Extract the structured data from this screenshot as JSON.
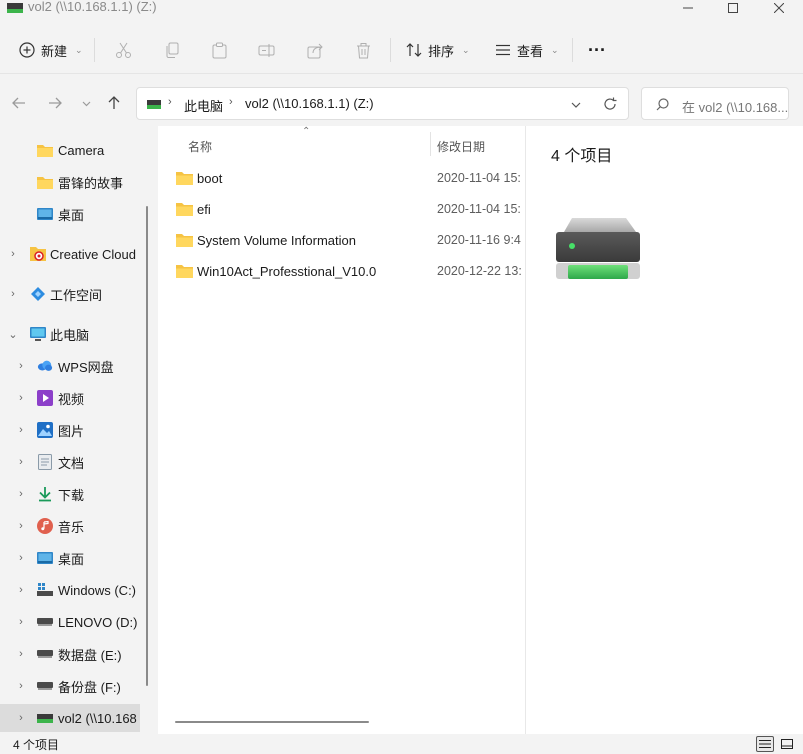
{
  "window": {
    "title": "vol2 (\\\\10.168.1.1) (Z:)"
  },
  "toolbar": {
    "new_label": "新建",
    "sort_label": "排序",
    "view_label": "查看",
    "more_label": "···"
  },
  "address": {
    "crumbs": [
      "此电脑",
      "vol2 (\\\\10.168.1.1) (Z:)"
    ]
  },
  "search": {
    "placeholder": "在 vol2 (\\\\10.168..."
  },
  "sidebar": {
    "items": [
      {
        "label": "Camera",
        "icon": "folder-icon"
      },
      {
        "label": "雷锋的故事",
        "icon": "folder-icon"
      },
      {
        "label": "桌面",
        "icon": "desktop-icon"
      },
      {
        "label": "Creative Cloud",
        "icon": "creative-cloud-icon"
      },
      {
        "label": "工作空间",
        "icon": "workspace-icon"
      },
      {
        "label": "此电脑",
        "icon": "computer-icon"
      },
      {
        "label": "WPS网盘",
        "icon": "cloud-icon"
      },
      {
        "label": "视频",
        "icon": "video-icon"
      },
      {
        "label": "图片",
        "icon": "pictures-icon"
      },
      {
        "label": "文档",
        "icon": "documents-icon"
      },
      {
        "label": "下载",
        "icon": "download-icon"
      },
      {
        "label": "音乐",
        "icon": "music-icon"
      },
      {
        "label": "桌面",
        "icon": "desktop-icon"
      },
      {
        "label": "Windows (C:)",
        "icon": "windows-drive-icon"
      },
      {
        "label": "LENOVO (D:)",
        "icon": "drive-icon"
      },
      {
        "label": "数据盘 (E:)",
        "icon": "drive-icon"
      },
      {
        "label": "备份盘 (F:)",
        "icon": "drive-icon"
      },
      {
        "label": "vol2 (\\\\10.168",
        "icon": "network-drive-icon"
      }
    ]
  },
  "columns": {
    "name": "名称",
    "modified": "修改日期"
  },
  "files": [
    {
      "name": "boot",
      "date": "2020-11-04 15:"
    },
    {
      "name": "efi",
      "date": "2020-11-04 15:"
    },
    {
      "name": "System Volume Information",
      "date": "2020-11-16 9:4"
    },
    {
      "name": "Win10Act_Professtional_V10.0",
      "date": "2020-12-22 13:"
    }
  ],
  "preview": {
    "count": "4 个项目"
  },
  "status": {
    "text": "4 个项目"
  },
  "colors": {
    "folder": "#f6c343",
    "accent": "#3cb44b",
    "selected": "#dcdcdc"
  }
}
